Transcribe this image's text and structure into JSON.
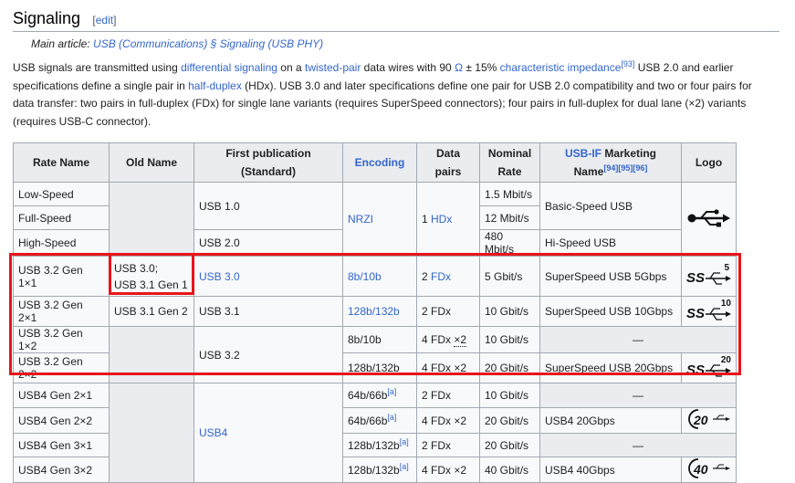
{
  "heading": {
    "title": "Signaling",
    "edit_prefix": "[",
    "edit": "edit",
    "edit_suffix": "]"
  },
  "hatnote": {
    "prefix": "Main article: ",
    "link": "USB (Communications) § Signaling (USB PHY)"
  },
  "paragraph": {
    "t1": "USB signals are transmitted using ",
    "l1": "differential signaling",
    "t2": " on a ",
    "l2": "twisted-pair",
    "t3": " data wires with 90 ",
    "l3": "Ω",
    "t4": " ± 15% ",
    "l4": "characteristic impedance",
    "ref1": "[93]",
    "t5": " USB 2.0 and earlier specifications define a single pair in ",
    "l5": "half-duplex",
    "t6": " (HDx). USB 3.0 and later specifications define one pair for USB 2.0 compatibility and two or four pairs for data transfer: two pairs in full-duplex (FDx) for single lane variants (requires SuperSpeed connectors); four pairs in full-duplex for dual lane (×2) variants (requires USB-C connector)."
  },
  "table": {
    "headers": {
      "rate_name": "Rate Name",
      "old_name": "Old Name",
      "first_pub": "First publication (Standard)",
      "encoding": "Encoding",
      "data_pairs": "Data pairs",
      "nominal_rate_1": "Nominal",
      "nominal_rate_2": "Rate",
      "marketing_link": "USB-IF",
      "marketing_1": " Marketing",
      "marketing_2": "Name",
      "marketing_refs": "[94][95][96]",
      "logo": "Logo"
    },
    "rows": {
      "r1": {
        "rate": "Low-Speed",
        "nominal": "1.5 Mbit/s"
      },
      "r2": {
        "rate": "Full-Speed",
        "nominal": "12 Mbit/s"
      },
      "r3": {
        "rate": "High-Speed",
        "nominal": "480 Mbit/s",
        "marketing": "Hi-Speed USB"
      },
      "r4": {
        "rate": "USB 3.2 Gen 1×1",
        "old1": "USB 3.0;",
        "old2": "USB 3.1 Gen 1",
        "pub": "USB 3.0",
        "enc": "8b/10b",
        "pairs_num": "2 ",
        "pairs_link": "FDx",
        "nominal": "5 Gbit/s",
        "marketing": "SuperSpeed USB 5Gbps",
        "logo_num": "5"
      },
      "r5": {
        "rate": "USB 3.2 Gen 2×1",
        "old": "USB 3.1 Gen 2",
        "pub": "USB 3.1",
        "enc": "128b/132b",
        "pairs": "2 FDx",
        "nominal": "10 Gbit/s",
        "marketing": "SuperSpeed USB 10Gbps",
        "logo_num": "10"
      },
      "r6": {
        "rate": "USB 3.2 Gen 1×2",
        "enc": "8b/10b",
        "pairs_prefix": "4 FDx ",
        "pairs_link": "×2",
        "nominal": "10 Gbit/s",
        "marketing": "—"
      },
      "r7": {
        "rate": "USB 3.2 Gen 2×2",
        "enc": "128b/132b",
        "pairs": "4 FDx ×2",
        "nominal": "20 Gbit/s",
        "marketing": "SuperSpeed USB 20Gbps",
        "logo_num": "20"
      },
      "r8": {
        "rate": "USB4 Gen 2×1",
        "enc": "64b/66b",
        "enc_ref": "[a]",
        "pairs": "2 FDx",
        "nominal": "10 Gbit/s",
        "marketing": "—"
      },
      "r9": {
        "rate": "USB4 Gen 2×2",
        "enc": "64b/66b",
        "enc_ref": "[a]",
        "pairs": "4 FDx ×2",
        "nominal": "20 Gbit/s",
        "marketing": "USB4 20Gbps",
        "logo_num": "20"
      },
      "r10": {
        "rate": "USB4 Gen 3×1",
        "enc": "128b/132b",
        "enc_ref": "[a]",
        "pairs": "2 FDx",
        "nominal": "20 Gbit/s",
        "marketing": "—"
      },
      "r11": {
        "rate": "USB4 Gen 3×2",
        "enc": "128b/132b",
        "enc_ref": "[a]",
        "pairs": "4 FDx ×2",
        "nominal": "40 Gbit/s",
        "marketing": "USB4 40Gbps",
        "logo_num": "40"
      }
    },
    "groups": {
      "pub_usb10": "USB 1.0",
      "pub_usb20": "USB 2.0",
      "pub_usb32": "USB 3.2",
      "pub_usb4": "USB4",
      "enc_nrzi": "NRZI",
      "pairs_low_num": "1 ",
      "pairs_low_link": "HDx",
      "marketing_basic": "Basic-Speed USB"
    }
  },
  "highlight_color": "#e8141a",
  "icons": {
    "usb_trident": "usb-trident-icon",
    "superspeed": "superspeed-logo-icon",
    "usb4": "usb4-logo-icon"
  }
}
